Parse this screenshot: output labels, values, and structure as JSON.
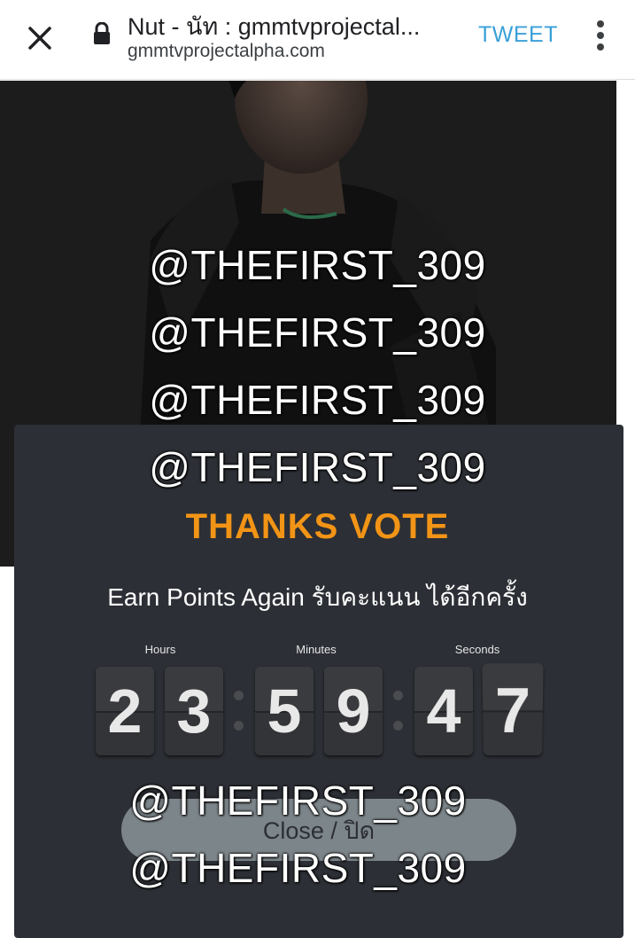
{
  "browser": {
    "title": "Nut - นัท : gmmtvprojectal...",
    "url": "gmmtvprojectalpha.com",
    "tweet_label": "TWEET"
  },
  "overlay_text": {
    "handles": [
      "@THEFIRST_309",
      "@THEFIRST_309",
      "@THEFIRST_309",
      "@THEFIRST_309"
    ],
    "bottom_handles": [
      "@THEFIRST_309",
      "@THEFIRST_309"
    ]
  },
  "modal": {
    "thanks": "THANKS VOTE",
    "earn_again": "Earn Points Again รับคะแนน ได้อีกครั้ง",
    "countdown": {
      "hours_label": "Hours",
      "minutes_label": "Minutes",
      "seconds_label": "Seconds",
      "digits": [
        "2",
        "3",
        "5",
        "9",
        "4",
        "7"
      ]
    },
    "close_label": "Close / ปิด"
  },
  "colors": {
    "accent": "#f29416",
    "tweet": "#3aa0d8",
    "modal_bg": "#2c2f35",
    "button_bg": "#7c858a"
  }
}
